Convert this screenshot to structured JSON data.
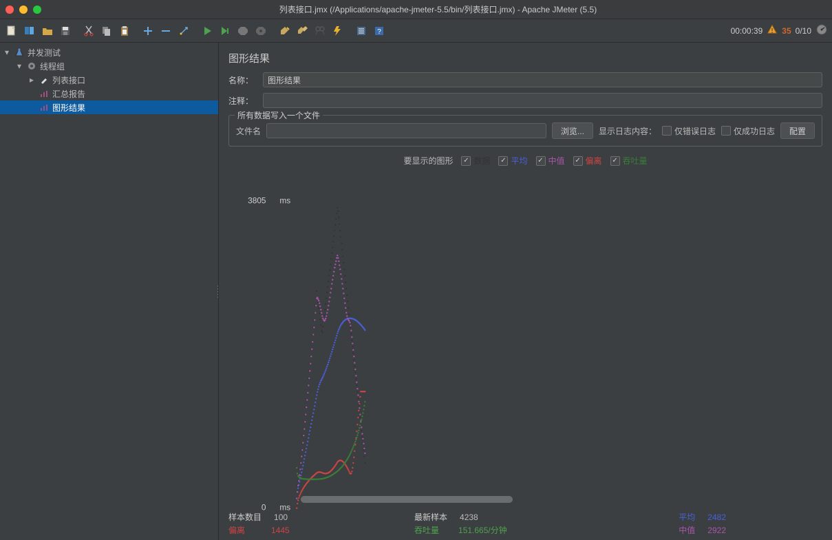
{
  "window_title": "列表接口.jmx (/Applications/apache-jmeter-5.5/bin/列表接口.jmx) - Apache JMeter (5.5)",
  "toolbar_status": {
    "timer": "00:00:39",
    "warn_count": "35",
    "threads": "0/10"
  },
  "tree": {
    "root": "并发测试",
    "thread_group": "线程组",
    "items": [
      "列表接口",
      "汇总报告",
      "图形结果"
    ]
  },
  "panel": {
    "title": "图形结果",
    "name_label": "名称：",
    "name_value": "图形结果",
    "comment_label": "注释：",
    "comment_value": "",
    "fieldset_label": "所有数据写入一个文件",
    "filename_label": "文件名",
    "filename_value": "",
    "browse_btn": "浏览...",
    "show_log_label": "显示日志内容：",
    "only_error": "仅错误日志",
    "only_success": "仅成功日志",
    "config_btn": "配置",
    "graphs_to_display": "要显示的图形",
    "legend": {
      "data": "数据",
      "avg": "平均",
      "median": "中值",
      "deviation": "偏离",
      "throughput": "吞吐量"
    },
    "y_max": "3805",
    "y_min": "0",
    "y_unit": "ms"
  },
  "stats": {
    "samples_label": "样本数目",
    "samples_value": "100",
    "deviation_label": "偏离",
    "deviation_value": "1445",
    "latest_label": "最新样本",
    "latest_value": "4238",
    "throughput_label": "吞吐量",
    "throughput_value": "151.665/分钟",
    "avg_label": "平均",
    "avg_value": "2482",
    "median_label": "中值",
    "median_value": "2922"
  },
  "chart_data": {
    "type": "scatter",
    "title": "图形结果",
    "ylabel": "ms",
    "ylim": [
      0,
      3805
    ],
    "x_range": [
      0,
      100
    ],
    "series": [
      {
        "name": "数据",
        "color": "#333333",
        "values": [
          120,
          280,
          340,
          410,
          480,
          560,
          640,
          720,
          810,
          900,
          980,
          1070,
          1160,
          1250,
          1340,
          1430,
          1520,
          1610,
          1700,
          1790,
          1880,
          1970,
          2060,
          2150,
          2240,
          2330,
          2420,
          2510,
          2600,
          2690,
          2620,
          2550,
          2480,
          2410,
          2340,
          2270,
          2200,
          2180,
          2250,
          2320,
          2390,
          2460,
          2530,
          2600,
          2670,
          2740,
          2810,
          2880,
          2950,
          3020,
          3090,
          3160,
          3230,
          3300,
          3370,
          3440,
          3510,
          3580,
          3650,
          3720,
          3680,
          3600,
          3520,
          3440,
          3360,
          3280,
          3200,
          3120,
          3040,
          2960,
          2880,
          2800,
          2720,
          2640,
          2560,
          2480,
          2400,
          2320,
          2240,
          2160,
          2080,
          2000,
          1920,
          1840,
          1760,
          1680,
          1600,
          1520,
          1440,
          1360,
          1280,
          1200,
          1120,
          1040,
          960,
          880,
          800,
          720,
          640,
          560
        ]
      },
      {
        "name": "平均",
        "color": "#4a5fd8",
        "values": [
          120,
          200,
          247,
          288,
          326,
          365,
          404,
          444,
          485,
          526,
          568,
          610,
          652,
          695,
          738,
          781,
          825,
          869,
          913,
          957,
          1001,
          1045,
          1089,
          1133,
          1177,
          1222,
          1266,
          1311,
          1356,
          1400,
          1440,
          1474,
          1505,
          1532,
          1555,
          1576,
          1593,
          1610,
          1627,
          1646,
          1666,
          1687,
          1709,
          1732,
          1756,
          1780,
          1805,
          1831,
          1857,
          1884,
          1911,
          1938,
          1966,
          1994,
          2022,
          2051,
          2079,
          2108,
          2137,
          2166,
          2191,
          2213,
          2233,
          2251,
          2267,
          2281,
          2294,
          2305,
          2315,
          2323,
          2330,
          2336,
          2341,
          2345,
          2348,
          2350,
          2351,
          2352,
          2352,
          2351,
          2349,
          2347,
          2344,
          2340,
          2336,
          2331,
          2326,
          2320,
          2313,
          2306,
          2298,
          2290,
          2281,
          2272,
          2262,
          2252,
          2241,
          2230,
          2218,
          2206
        ]
      },
      {
        "name": "中值",
        "color": "#aa55aa",
        "values": [
          120,
          200,
          280,
          340,
          410,
          480,
          560,
          640,
          720,
          810,
          900,
          980,
          1070,
          1160,
          1250,
          1340,
          1430,
          1520,
          1610,
          1700,
          1790,
          1880,
          1970,
          2060,
          2150,
          2240,
          2330,
          2420,
          2510,
          2600,
          2610,
          2590,
          2570,
          2540,
          2500,
          2460,
          2420,
          2380,
          2350,
          2330,
          2320,
          2330,
          2350,
          2380,
          2420,
          2460,
          2510,
          2560,
          2610,
          2670,
          2720,
          2780,
          2830,
          2880,
          2930,
          2980,
          3020,
          3060,
          3100,
          3130,
          3100,
          3060,
          3010,
          2960,
          2900,
          2840,
          2780,
          2720,
          2660,
          2600,
          2540,
          2480,
          2422,
          2380,
          2350,
          2330,
          2320,
          2300,
          2260,
          2200,
          2120,
          2040,
          1960,
          1880,
          1800,
          1720,
          1640,
          1560,
          1480,
          1400,
          1320,
          1240,
          1160,
          1080,
          1000,
          922,
          860,
          800,
          740,
          680
        ]
      },
      {
        "name": "偏离",
        "color": "#cc4444",
        "values": [
          0,
          57,
          97,
          127,
          151,
          172,
          191,
          208,
          224,
          239,
          253,
          266,
          279,
          291,
          303,
          314,
          325,
          335,
          345,
          355,
          364,
          373,
          382,
          390,
          398,
          406,
          414,
          421,
          429,
          436,
          441,
          444,
          446,
          447,
          446,
          444,
          441,
          438,
          435,
          432,
          430,
          429,
          429,
          430,
          432,
          435,
          439,
          444,
          450,
          457,
          465,
          474,
          483,
          494,
          505,
          516,
          529,
          542,
          555,
          569,
          579,
          586,
          590,
          592,
          591,
          588,
          583,
          576,
          568,
          558,
          546,
          533,
          519,
          504,
          488,
          471,
          453,
          434,
          426,
          430,
          455,
          500,
          560,
          630,
          706,
          786,
          868,
          952,
          1037,
          1122,
          1208,
          1293,
          1379,
          1445,
          1445,
          1445,
          1445,
          1445,
          1445,
          1445
        ]
      },
      {
        "name": "吞吐量",
        "color": "#3a7c3a",
        "values": [
          500,
          428,
          400,
          387,
          379,
          374,
          370,
          367,
          365,
          364,
          362,
          361,
          360,
          360,
          359,
          359,
          358,
          358,
          358,
          358,
          358,
          358,
          358,
          358,
          358,
          358,
          358,
          358,
          358,
          358,
          358,
          359,
          359,
          360,
          361,
          362,
          363,
          364,
          366,
          368,
          370,
          372,
          375,
          378,
          381,
          384,
          388,
          392,
          396,
          400,
          405,
          410,
          415,
          420,
          426,
          432,
          438,
          444,
          451,
          458,
          465,
          473,
          481,
          490,
          499,
          508,
          518,
          529,
          540,
          551,
          563,
          576,
          589,
          602,
          617,
          632,
          647,
          664,
          681,
          699,
          718,
          737,
          758,
          779,
          802,
          825,
          850,
          876,
          903,
          932,
          962,
          994,
          1027,
          1062,
          1099,
          1138,
          1179,
          1223,
          1269,
          1318
        ]
      }
    ]
  }
}
